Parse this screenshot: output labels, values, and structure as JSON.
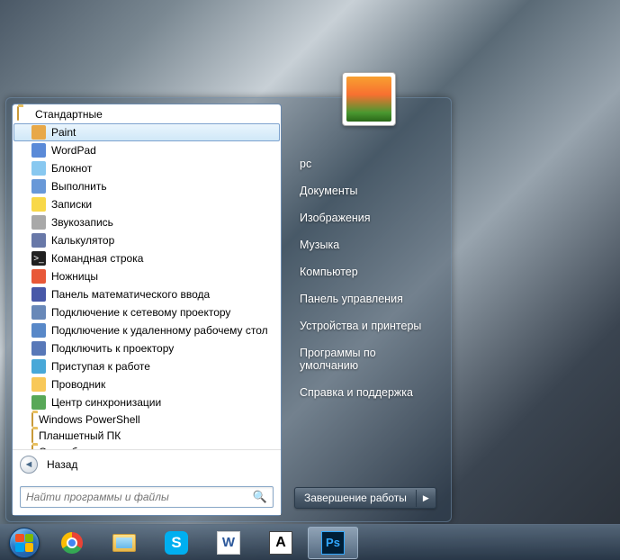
{
  "start_menu": {
    "folder_label": "Стандартные",
    "programs": [
      {
        "label": "Paint",
        "icon": "paint-icon",
        "selected": true
      },
      {
        "label": "WordPad",
        "icon": "wordpad-icon"
      },
      {
        "label": "Блокнот",
        "icon": "notepad-icon"
      },
      {
        "label": "Выполнить",
        "icon": "run-icon"
      },
      {
        "label": "Записки",
        "icon": "sticky-notes-icon"
      },
      {
        "label": "Звукозапись",
        "icon": "sound-recorder-icon"
      },
      {
        "label": "Калькулятор",
        "icon": "calculator-icon"
      },
      {
        "label": "Командная строка",
        "icon": "cmd-icon"
      },
      {
        "label": "Ножницы",
        "icon": "snipping-tool-icon"
      },
      {
        "label": "Панель математического ввода",
        "icon": "math-input-icon"
      },
      {
        "label": "Подключение к сетевому проектору",
        "icon": "network-projector-icon"
      },
      {
        "label": "Подключение к удаленному рабочему стол",
        "icon": "remote-desktop-icon"
      },
      {
        "label": "Подключить к проектору",
        "icon": "projector-icon"
      },
      {
        "label": "Приступая к работе",
        "icon": "getting-started-icon"
      },
      {
        "label": "Проводник",
        "icon": "explorer-icon"
      },
      {
        "label": "Центр синхронизации",
        "icon": "sync-center-icon"
      }
    ],
    "subfolders": [
      {
        "label": "Windows PowerShell"
      },
      {
        "label": "Планшетный ПК"
      },
      {
        "label": "Служебные"
      }
    ],
    "back_label": "Назад",
    "search_placeholder": "Найти программы и файлы",
    "right_items": [
      "pc",
      "Документы",
      "Изображения",
      "Музыка",
      "Компьютер",
      "Панель управления",
      "Устройства и принтеры",
      "Программы по умолчанию",
      "Справка и поддержка"
    ],
    "shutdown_label": "Завершение работы"
  },
  "icon_colors": {
    "paint-icon": "#e8a848",
    "wordpad-icon": "#5a8ad8",
    "notepad-icon": "#88c8f0",
    "run-icon": "#6898d8",
    "sticky-notes-icon": "#f8d848",
    "sound-recorder-icon": "#a8a8a8",
    "calculator-icon": "#6878a8",
    "cmd-icon": "#202020",
    "snipping-tool-icon": "#e85838",
    "math-input-icon": "#4858a8",
    "network-projector-icon": "#6888b8",
    "remote-desktop-icon": "#5888c8",
    "projector-icon": "#5878b8",
    "getting-started-icon": "#48a8d8",
    "explorer-icon": "#f8c858",
    "sync-center-icon": "#58a858"
  },
  "taskbar": {
    "items": [
      {
        "name": "chrome",
        "color1": "#ea4335",
        "color2": "#4285f4",
        "color3": "#fbbc05",
        "color4": "#34a853"
      },
      {
        "name": "explorer",
        "color": "#f8c858"
      },
      {
        "name": "skype",
        "color": "#00aff0"
      },
      {
        "name": "word",
        "color": "#2b579a"
      },
      {
        "name": "app-a",
        "color": "#ffffff"
      },
      {
        "name": "photoshop",
        "color": "#001e36",
        "active": true
      }
    ]
  }
}
